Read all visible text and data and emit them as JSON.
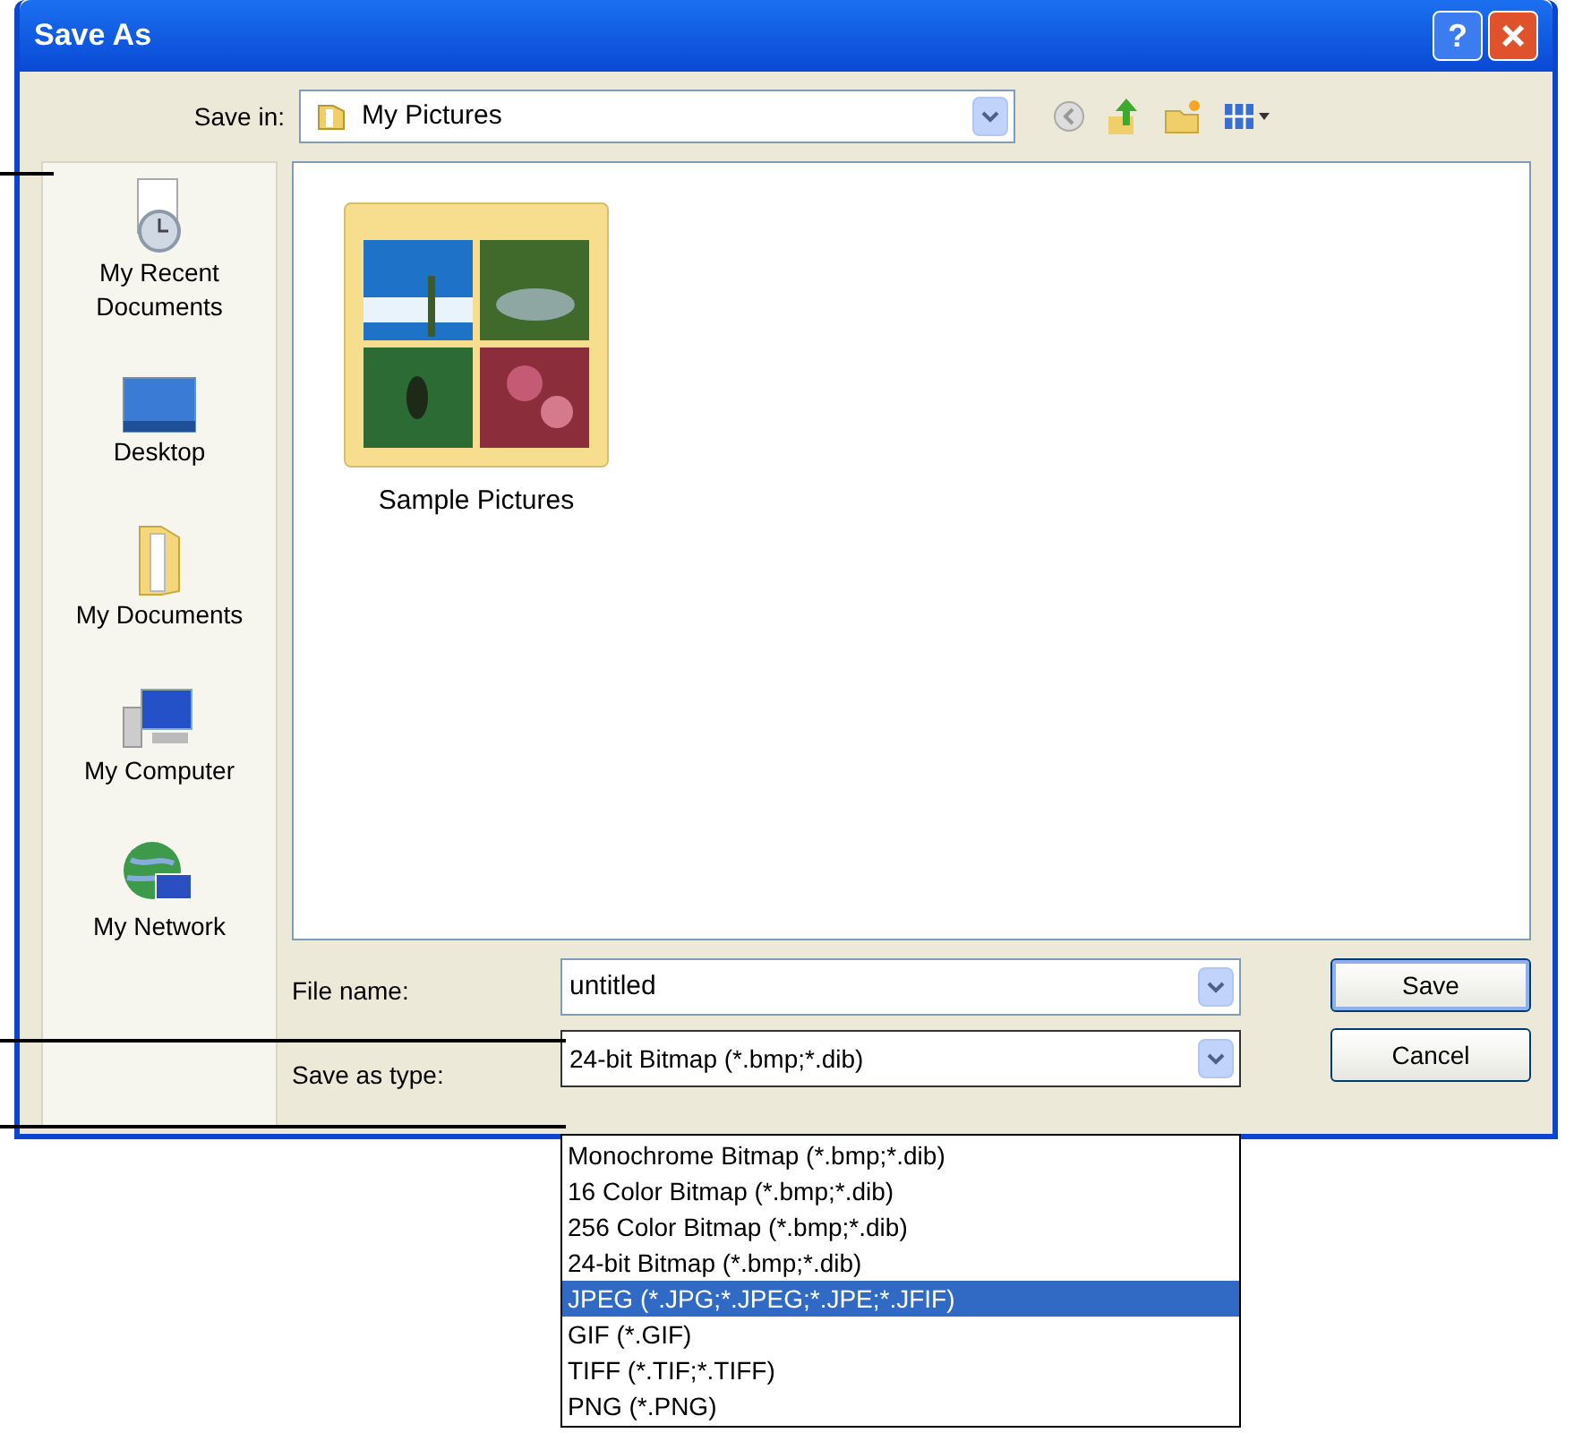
{
  "window": {
    "title": "Save As",
    "help": "?"
  },
  "save_in": {
    "label": "Save in:",
    "value": "My Pictures"
  },
  "places": [
    {
      "label": "My Recent Documents",
      "kind": "recent"
    },
    {
      "label": "Desktop",
      "kind": "desktop"
    },
    {
      "label": "My Documents",
      "kind": "documents"
    },
    {
      "label": "My Computer",
      "kind": "computer"
    },
    {
      "label": "My Network",
      "kind": "network"
    }
  ],
  "files": [
    {
      "name": "Sample Pictures",
      "kind": "picture-folder"
    }
  ],
  "file_name": {
    "label": "File name:",
    "value": "untitled"
  },
  "save_as_type": {
    "label": "Save as type:",
    "value": "24-bit Bitmap (*.bmp;*.dib)",
    "expanded": true
  },
  "type_options": [
    {
      "label": "Monochrome Bitmap (*.bmp;*.dib)",
      "selected": false
    },
    {
      "label": "16 Color Bitmap (*.bmp;*.dib)",
      "selected": false
    },
    {
      "label": "256 Color Bitmap (*.bmp;*.dib)",
      "selected": false
    },
    {
      "label": "24-bit Bitmap (*.bmp;*.dib)",
      "selected": false
    },
    {
      "label": "JPEG (*.JPG;*.JPEG;*.JPE;*.JFIF)",
      "selected": true
    },
    {
      "label": "GIF (*.GIF)",
      "selected": false
    },
    {
      "label": "TIFF (*.TIF;*.TIFF)",
      "selected": false
    },
    {
      "label": "PNG (*.PNG)",
      "selected": false
    }
  ],
  "buttons": [
    {
      "label": "Save",
      "kind": "default"
    },
    {
      "label": "Cancel",
      "kind": "normal"
    }
  ]
}
